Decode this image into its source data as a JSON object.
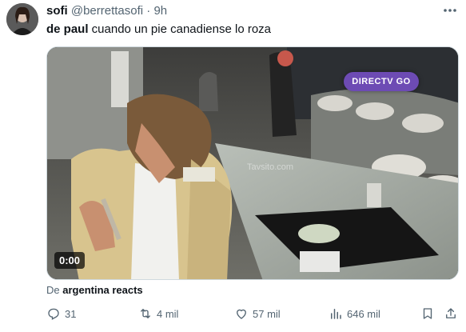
{
  "tweet": {
    "display_name": "sofi",
    "handle": "@berrettasofi",
    "separator": "·",
    "time": "9h",
    "text_bold": "de paul",
    "text_rest": " cuando un pie canadiense lo roza"
  },
  "media": {
    "brand_label": "DIRECTV GO",
    "timestamp": "0:00",
    "watermark": "Tavsito.com",
    "source_prefix": "De ",
    "source_name": "argentina reacts"
  },
  "actions": {
    "replies": "31",
    "reposts": "4 mil",
    "likes": "57 mil",
    "views": "646 mil"
  },
  "icons": [
    "more-icon",
    "reply-icon",
    "repost-icon",
    "like-icon",
    "views-icon",
    "bookmark-icon",
    "share-icon"
  ],
  "colors": {
    "secondary_text": "#536471",
    "primary_text": "#0f1419",
    "brand_badge": "#6d4bb4"
  }
}
